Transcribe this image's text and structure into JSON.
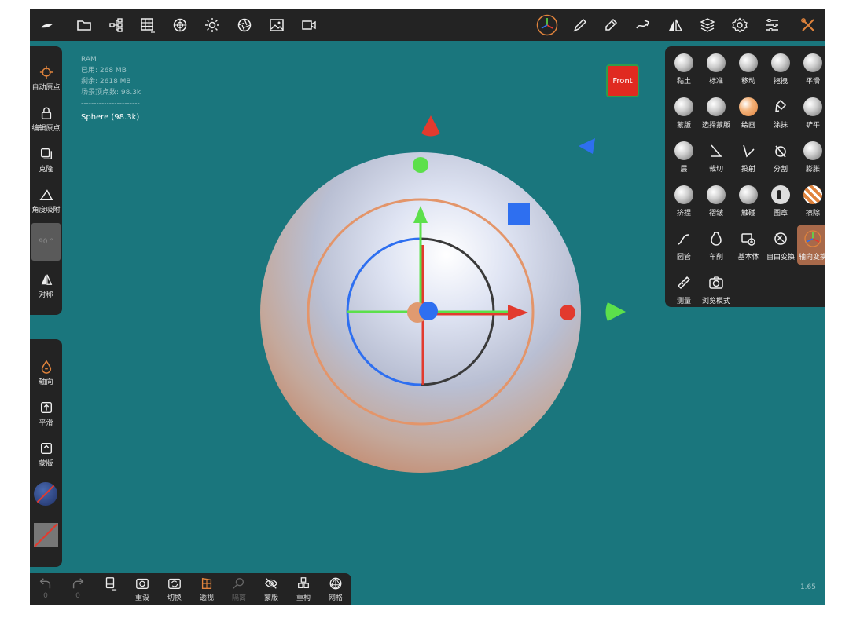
{
  "info": {
    "ram_label": "RAM",
    "used": "已用:  268 MB",
    "free": "剩余:  2618 MB",
    "vertices": "场景顶点数: 98.3k",
    "divider": "-----------------------",
    "selected": "Sphere (98.3k)"
  },
  "view_cube": {
    "label": "Front"
  },
  "left_tools": {
    "auto_origin": "自动原点",
    "edit_origin": "编辑原点",
    "clone": "克隆",
    "angle_snap": "角度吸附",
    "angle_value": "90 °",
    "symmetry": "对称"
  },
  "left_tools2": {
    "axis": "轴向",
    "smooth": "平滑",
    "mask": "蒙版"
  },
  "right_tools": [
    {
      "label": "黏土"
    },
    {
      "label": "标准"
    },
    {
      "label": "移动"
    },
    {
      "label": "拖拽"
    },
    {
      "label": "平滑"
    },
    {
      "label": "蒙版"
    },
    {
      "label": "选择蒙版"
    },
    {
      "label": "绘画"
    },
    {
      "label": "涂抹"
    },
    {
      "label": "铲平"
    },
    {
      "label": "层"
    },
    {
      "label": "裁切"
    },
    {
      "label": "投射"
    },
    {
      "label": "分割"
    },
    {
      "label": "膨胀"
    },
    {
      "label": "挤捏"
    },
    {
      "label": "褶皱"
    },
    {
      "label": "触碰"
    },
    {
      "label": "图章"
    },
    {
      "label": "擦除"
    },
    {
      "label": "圆管"
    },
    {
      "label": "车削"
    },
    {
      "label": "基本体"
    },
    {
      "label": "自由变换"
    },
    {
      "label": "轴向变换"
    },
    {
      "label": "测量"
    },
    {
      "label": "浏览模式"
    }
  ],
  "bottom": {
    "undo_count": "0",
    "redo_count": "0",
    "reset": "重设",
    "switch": "切换",
    "perspective": "透视",
    "isolate": "隔离",
    "mask": "蒙版",
    "remesh": "重构",
    "mesh": "网格"
  },
  "version": "1.65",
  "colors": {
    "accent": "#e0833c",
    "viewport": "#1a767d",
    "panel": "#232323"
  }
}
